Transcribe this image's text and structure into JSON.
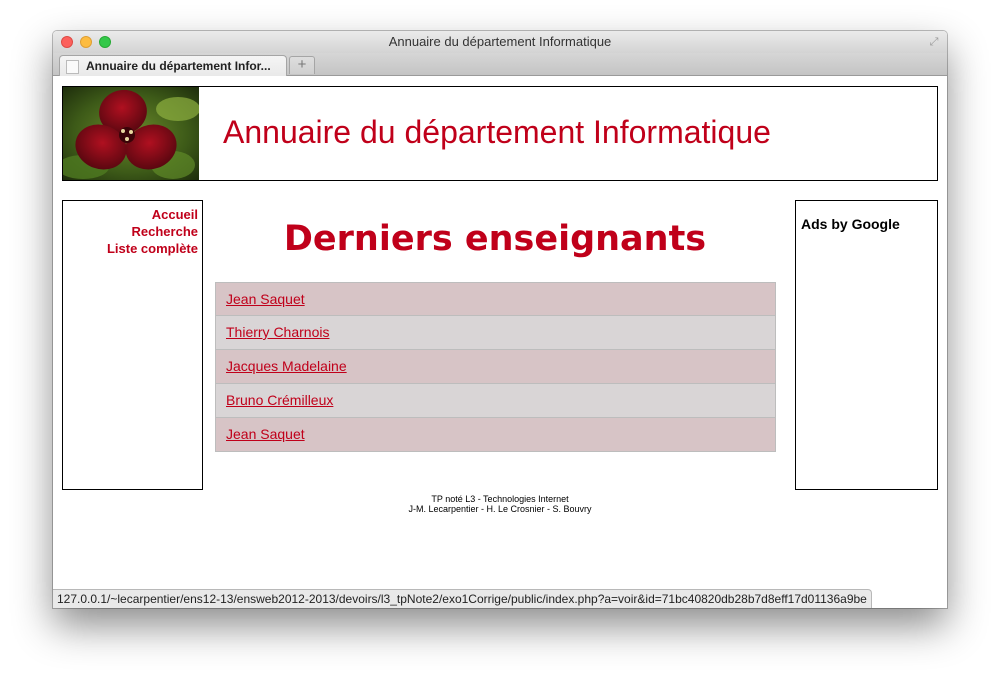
{
  "window": {
    "title": "Annuaire du département Informatique"
  },
  "tabs": {
    "active_label": "Annuaire du département Infor...",
    "new_tab_label": "+"
  },
  "header": {
    "site_title": "Annuaire du département Informatique",
    "logo_icon": "red-flower-photo"
  },
  "nav": {
    "items": [
      {
        "label": "Accueil"
      },
      {
        "label": "Recherche"
      },
      {
        "label": "Liste complète"
      }
    ]
  },
  "ads": {
    "label": "Ads by Google"
  },
  "main": {
    "heading": "Derniers enseignants",
    "teachers": [
      {
        "name": "Jean Saquet"
      },
      {
        "name": "Thierry Charnois"
      },
      {
        "name": "Jacques Madelaine"
      },
      {
        "name": "Bruno Crémilleux"
      },
      {
        "name": "Jean Saquet"
      }
    ]
  },
  "footer": {
    "line1": "TP noté L3 - Technologies Internet",
    "line2": "J-M. Lecarpentier - H. Le Crosnier - S. Bouvry"
  },
  "status": {
    "url": "127.0.0.1/~lecarpentier/ens12-13/ensweb2012-2013/devoirs/l3_tpNote2/exo1Corrige/public/index.php?a=voir&id=71bc40820db28b7d8eff17d01136a9be"
  },
  "colors": {
    "accent": "#c0001a",
    "row_odd": "#d7c4c6",
    "row_even": "#d9d5d6"
  }
}
